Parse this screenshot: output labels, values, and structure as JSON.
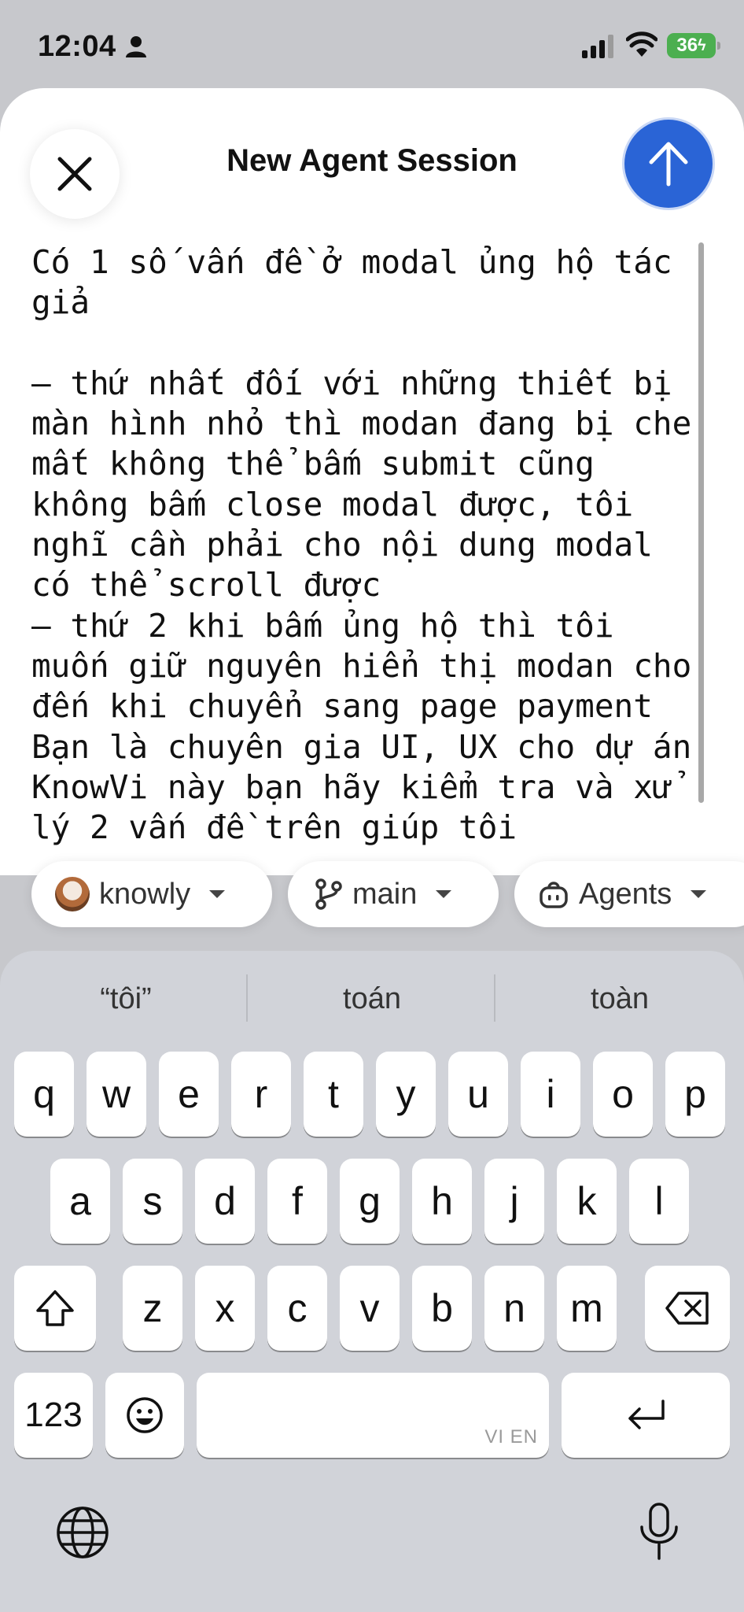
{
  "status_bar": {
    "time": "12:04",
    "battery": "36",
    "icons": [
      "person-icon",
      "signal-icon",
      "wifi-icon",
      "battery-charging-icon"
    ]
  },
  "header": {
    "title": "New Agent Session",
    "close_icon": "close-icon",
    "send_icon": "arrow-up-icon",
    "send_color": "#2a64d6"
  },
  "editor": {
    "text": "Có 1 số vấn đề ở modal ủng hộ tác giả\n\n– thứ nhất đối với những thiết bị màn hình nhỏ thì modan đang bị che mất không thể bấm submit cũng không bấm close modal được, tôi nghĩ cần phải cho nội dung modal có thể scroll được\n– thứ 2 khi bấm ủng hộ thì tôi muốn giữ nguyên hiển thị modan cho đến khi chuyển sang page payment\nBạn là chuyên gia UI, UX cho dự án KnowVi này bạn hãy kiểm tra và xử lý 2 vấn đề trên giúp tôi"
  },
  "chips": {
    "project": "knowly",
    "branch": "main",
    "agent": "Agents"
  },
  "keyboard": {
    "suggestions": [
      "“tôi”",
      "toán",
      "toàn"
    ],
    "row1": [
      "q",
      "w",
      "e",
      "r",
      "t",
      "y",
      "u",
      "i",
      "o",
      "p"
    ],
    "row2": [
      "a",
      "s",
      "d",
      "f",
      "g",
      "h",
      "j",
      "k",
      "l"
    ],
    "row3": [
      "z",
      "x",
      "c",
      "v",
      "b",
      "n",
      "m"
    ],
    "numbers_label": "123",
    "space_lang": "VI EN"
  }
}
